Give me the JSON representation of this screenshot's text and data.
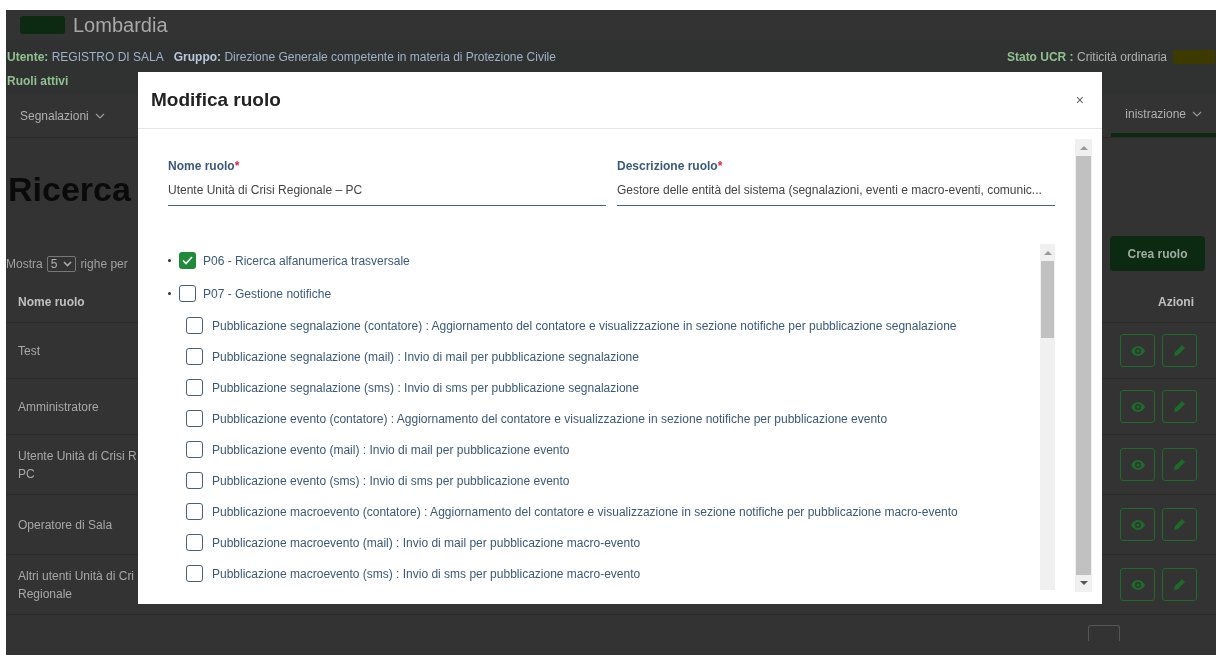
{
  "header": {
    "logo_text": "Lombardia",
    "user_label": "Utente:",
    "user": "REGISTRO DI SALA",
    "group_label": "Gruppo:",
    "group": "Direzione Generale competente in materia di Protezione Civile",
    "roles_link": "Ruoli attivi",
    "status_label": "Stato UCR :",
    "status": "Criticità ordinaria"
  },
  "nav": [
    {
      "label": "Segnalazioni"
    },
    {
      "label": "inistrazione"
    }
  ],
  "page": {
    "title": "Ricerca",
    "show_label": "Mostra",
    "page_size": "5",
    "per_page_label": "righe per",
    "create_button": "Crea ruolo"
  },
  "table": {
    "columns": [
      "Nome ruolo",
      "Azioni"
    ],
    "rows": [
      {
        "name": [
          "Test"
        ]
      },
      {
        "name": [
          "Amministratore"
        ]
      },
      {
        "name": [
          "Utente Unità di Crisi R",
          "PC"
        ]
      },
      {
        "name": [
          "Operatore di Sala"
        ]
      },
      {
        "name": [
          "Altri utenti Unità di Cri",
          "Regionale"
        ]
      }
    ]
  },
  "modal": {
    "title": "Modifica ruolo",
    "close": "×",
    "fields": [
      {
        "label": "Nome ruolo",
        "required_mark": "*",
        "value": "Utente Unità di Crisi Regionale – PC"
      },
      {
        "label": "Descrizione ruolo",
        "required_mark": "*",
        "value": "Gestore delle entità del sistema (segnalazioni, eventi e macro-eventi, comunic..."
      }
    ],
    "permissions": [
      {
        "label": "P06 - Ricerca alfanumerica trasversale",
        "checked": true
      },
      {
        "label": "P07 - Gestione notifiche",
        "checked": false,
        "children": [
          {
            "label": "Pubblicazione segnalazione (contatore) : Aggiornamento del contatore e visualizzazione in sezione notifiche per pubblicazione segnalazione",
            "checked": false
          },
          {
            "label": "Pubblicazione segnalazione (mail) : Invio di mail per pubblicazione segnalazione",
            "checked": false
          },
          {
            "label": "Pubblicazione segnalazione (sms) : Invio di sms per pubblicazione segnalazione",
            "checked": false
          },
          {
            "label": "Pubblicazione evento (contatore) : Aggiornamento del contatore e visualizzazione in sezione notifiche per pubblicazione evento",
            "checked": false
          },
          {
            "label": "Pubblicazione evento (mail) : Invio di mail per pubblicazione evento",
            "checked": false
          },
          {
            "label": "Pubblicazione evento (sms) : Invio di sms per pubblicazione evento",
            "checked": false
          },
          {
            "label": "Pubblicazione macroevento (contatore) : Aggiornamento del contatore e visualizzazione in sezione notifiche per pubblicazione macro-evento",
            "checked": false
          },
          {
            "label": "Pubblicazione macroevento (mail) : Invio di mail per pubblicazione macro-evento",
            "checked": false
          },
          {
            "label": "Pubblicazione macroevento (sms) : Invio di sms per pubblicazione macro-evento",
            "checked": false
          }
        ]
      }
    ]
  }
}
